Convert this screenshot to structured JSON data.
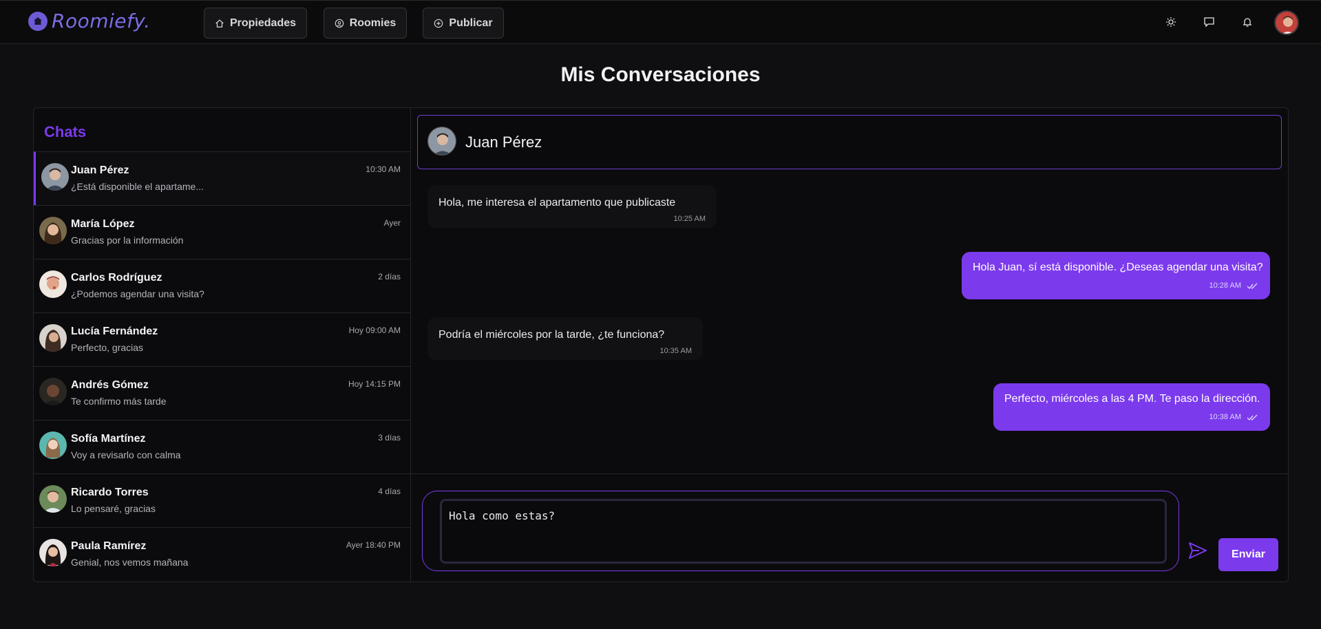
{
  "brand": {
    "name": "Roomiefy."
  },
  "nav": {
    "items": [
      {
        "label": "Propiedades",
        "icon": "home-icon"
      },
      {
        "label": "Roomies",
        "icon": "user-circle-icon"
      },
      {
        "label": "Publicar",
        "icon": "plus-circle-icon"
      }
    ]
  },
  "header_icons": [
    "sun-icon",
    "chat-icon",
    "bell-icon",
    "avatar"
  ],
  "page": {
    "title": "Mis Conversaciones"
  },
  "sidebar": {
    "title": "Chats",
    "chats": [
      {
        "name": "Juan Pérez",
        "preview": "¿Está disponible el apartame...",
        "time": "10:30 AM",
        "active": true
      },
      {
        "name": "María López",
        "preview": "Gracias por la información",
        "time": "Ayer"
      },
      {
        "name": "Carlos Rodríguez",
        "preview": "¿Podemos agendar una visita?",
        "time": "2 días"
      },
      {
        "name": "Lucía Fernández",
        "preview": "Perfecto, gracias",
        "time": "Hoy 09:00 AM"
      },
      {
        "name": "Andrés Gómez",
        "preview": "Te confirmo más tarde",
        "time": "Hoy 14:15 PM"
      },
      {
        "name": "Sofía Martínez",
        "preview": "Voy a revisarlo con calma",
        "time": "3 días"
      },
      {
        "name": "Ricardo Torres",
        "preview": "Lo pensaré, gracias",
        "time": "4 días"
      },
      {
        "name": "Paula Ramírez",
        "preview": "Genial, nos vemos mañana",
        "time": "Ayer 18:40 PM"
      }
    ]
  },
  "conversation": {
    "contact": "Juan Pérez",
    "messages": [
      {
        "direction": "in",
        "text": "Hola, me interesa el apartamento que publicaste",
        "time": "10:25 AM"
      },
      {
        "direction": "out",
        "text": "Hola Juan, sí está disponible. ¿Deseas agendar una visita?",
        "time": "10:28 AM",
        "read": true
      },
      {
        "direction": "in",
        "text": "Podría el miércoles por la tarde, ¿te funciona?",
        "time": "10:35 AM"
      },
      {
        "direction": "out",
        "text": "Perfecto, miércoles a las 4 PM. Te paso la dirección.",
        "time": "10:38 AM",
        "read": true
      }
    ]
  },
  "composer": {
    "value": "Hola como estas?",
    "send_label": "Enviar"
  },
  "colors": {
    "accent": "#7c3aed",
    "background": "#0f0f11",
    "surface": "#0b0b0d"
  }
}
